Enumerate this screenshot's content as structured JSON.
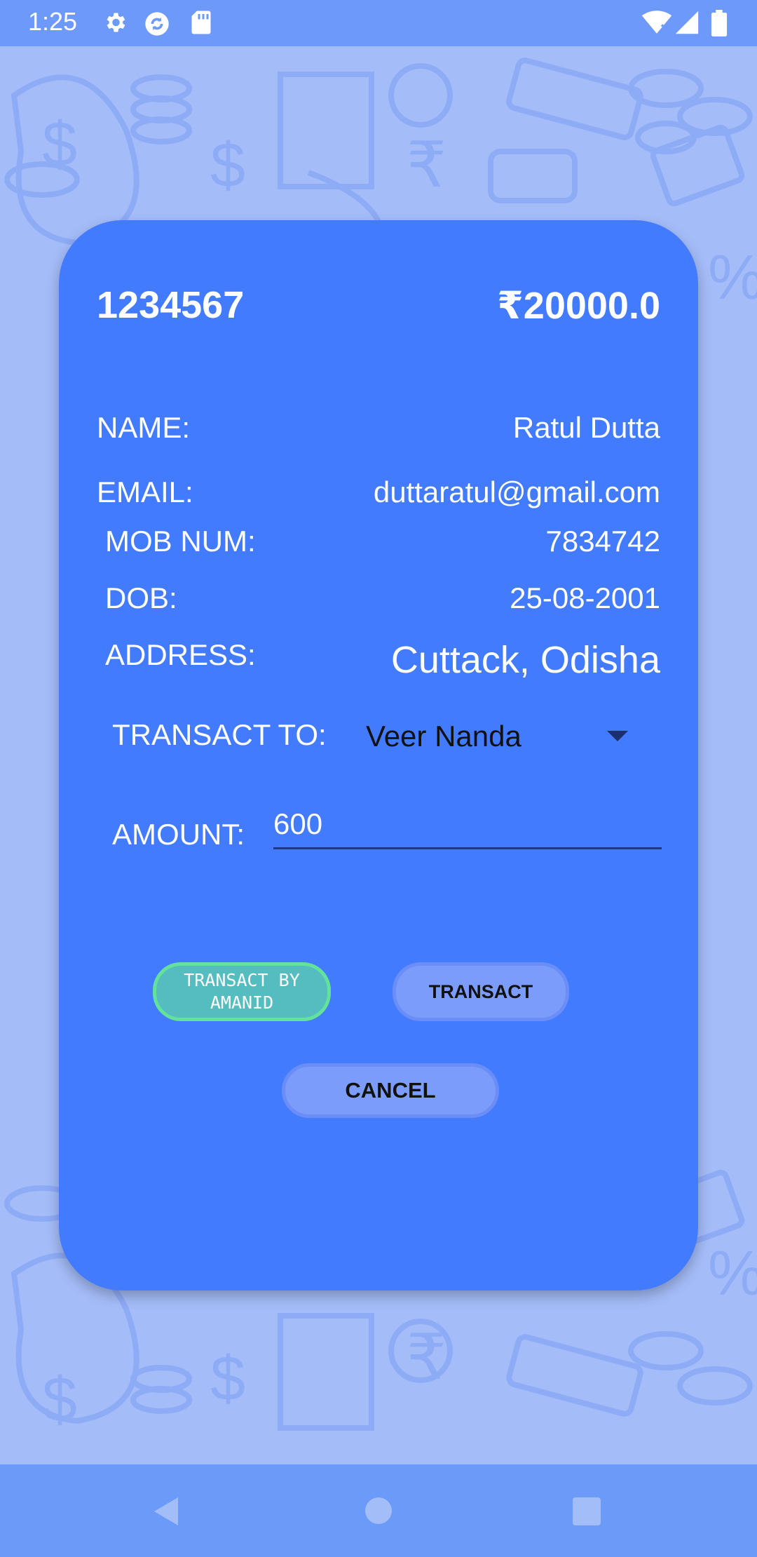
{
  "status_bar": {
    "time": "1:25",
    "icons": [
      "gear-icon",
      "sync-icon",
      "sd-card-icon",
      "wifi-icon",
      "signal-icon",
      "battery-icon"
    ]
  },
  "account": {
    "number": "1234567",
    "balance": "₹20000.0"
  },
  "details": {
    "name_label": "NAME:",
    "name_value": "Ratul Dutta",
    "email_label": "EMAIL:",
    "email_value": "duttaratul@gmail.com",
    "mob_label": "MOB NUM:",
    "mob_value": "7834742",
    "dob_label": "DOB:",
    "dob_value": "25-08-2001",
    "address_label": "ADDRESS:",
    "address_value": "Cuttack, Odisha"
  },
  "transfer": {
    "to_label": "TRANSACT TO:",
    "to_selected": "Veer Nanda",
    "amount_label": "AMOUNT:",
    "amount_value": "600"
  },
  "buttons": {
    "amanid": "TRANSACT BY AMANID",
    "transact": "TRANSACT",
    "cancel": "CANCEL"
  },
  "colors": {
    "card": "#437bff",
    "background": "#a4bcf8",
    "status_bar": "#6d99fb",
    "amanid_button": "#55bdbf",
    "amanid_border": "#63e29b",
    "button": "#7b9cfa"
  },
  "nav_bar": {
    "icons": [
      "back-icon",
      "home-icon",
      "recents-icon"
    ]
  }
}
